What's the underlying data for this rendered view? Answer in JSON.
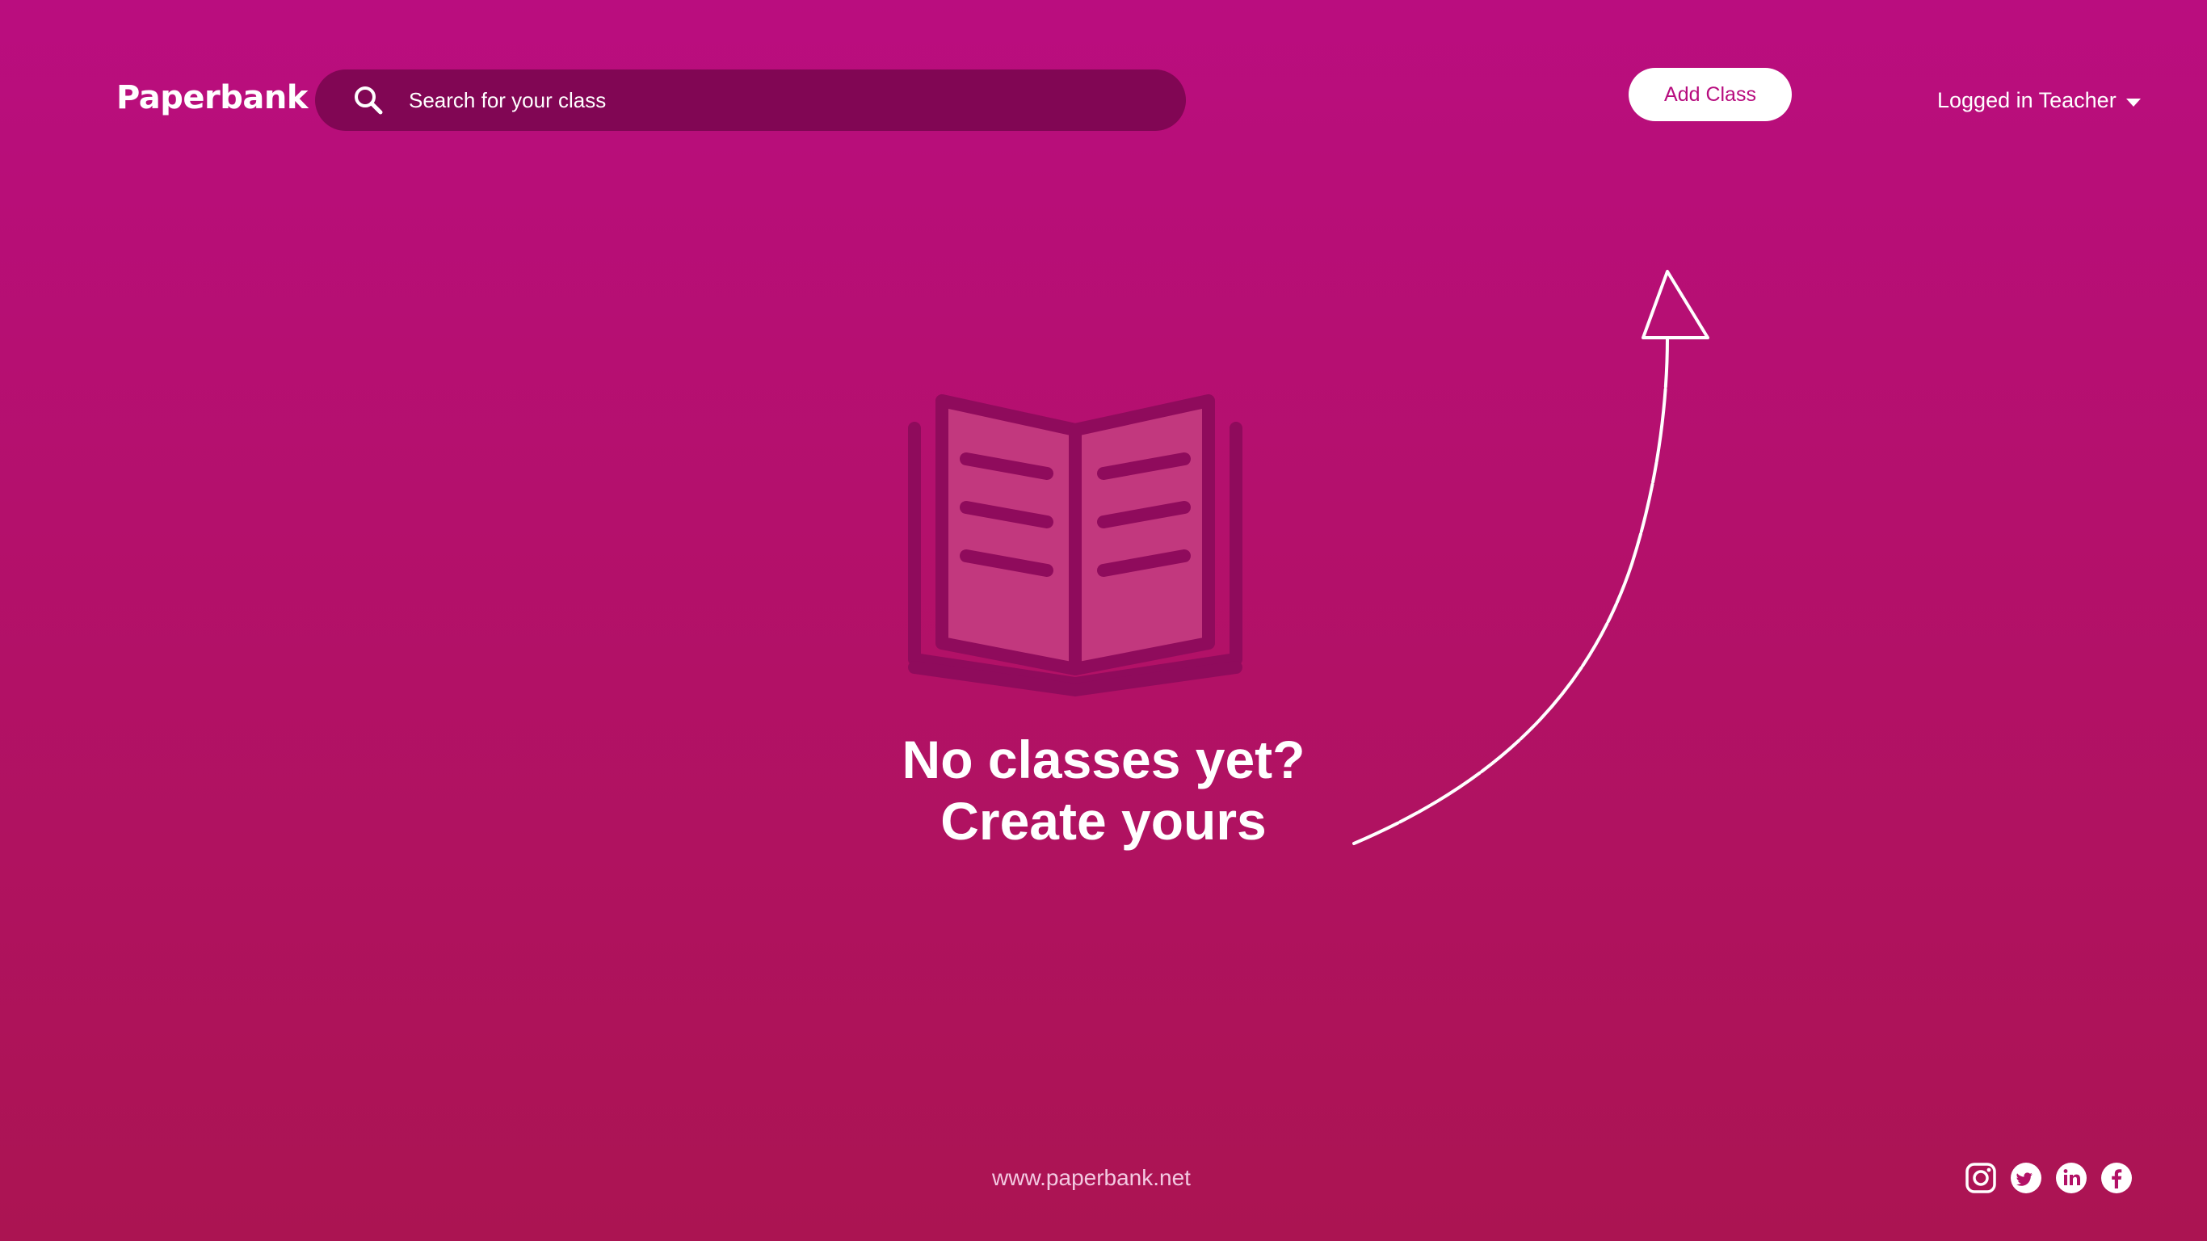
{
  "header": {
    "logo": "Paperbank",
    "search": {
      "placeholder": "Search for your class",
      "icon": "search-icon"
    },
    "add_class_label": "Add Class",
    "user_label": "Logged in Teacher"
  },
  "empty_state": {
    "illustration": "open-book-icon",
    "line1": "No classes yet?",
    "line2": "Create yours"
  },
  "footer": {
    "url": "www.paperbank.net",
    "social": [
      "instagram-icon",
      "twitter-icon",
      "linkedin-icon",
      "facebook-icon"
    ]
  },
  "colors": {
    "background_top": "#BA0D7F",
    "background_bottom": "#AB1452",
    "search_bg": "#810654",
    "accent_text": "#B70C7E",
    "book": "#8F0B5C"
  }
}
